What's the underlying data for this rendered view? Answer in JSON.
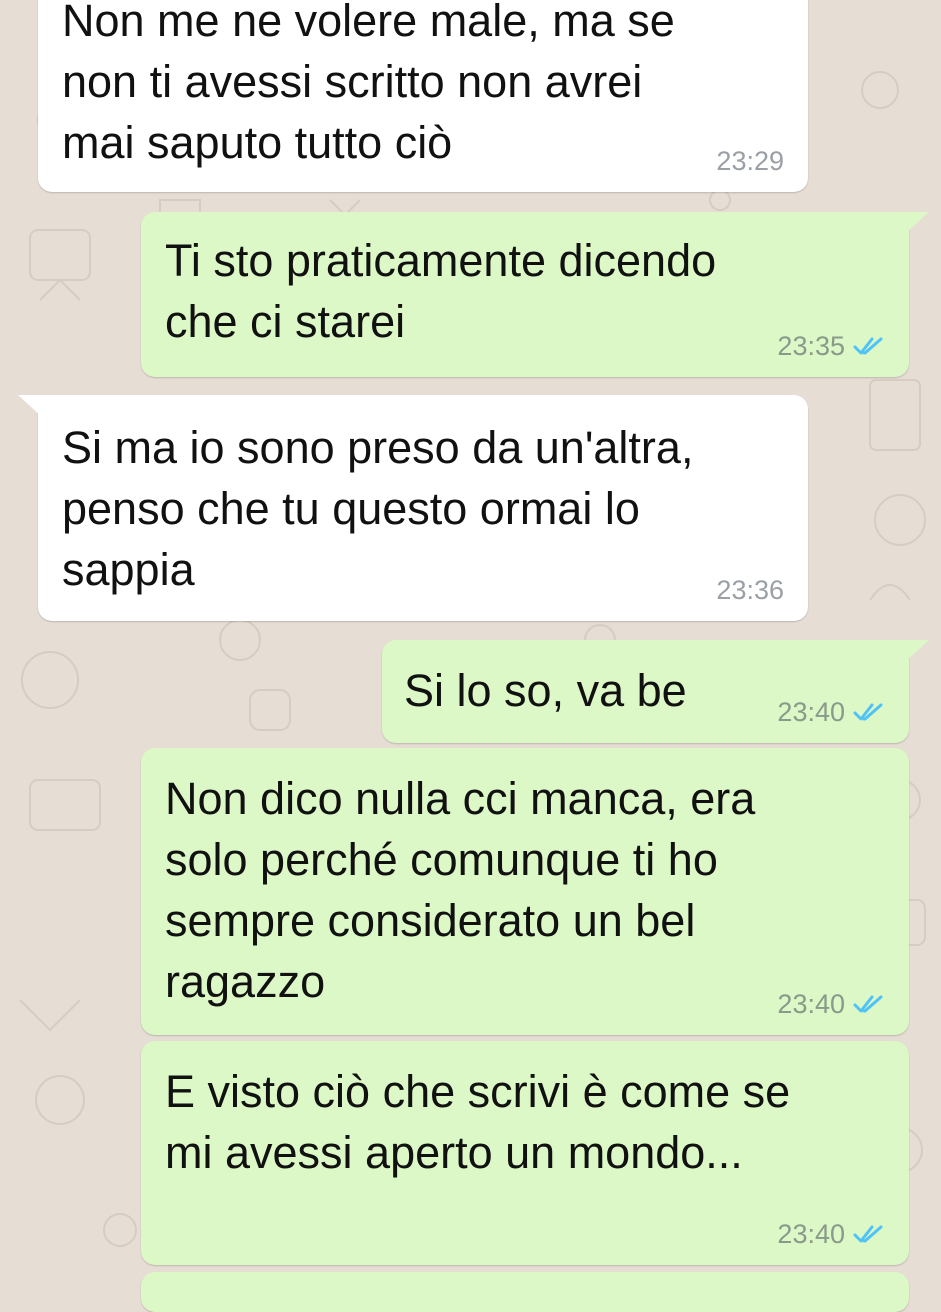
{
  "colors": {
    "wallpaper": "#e6ddd4",
    "incoming_bubble": "#ffffff",
    "outgoing_bubble": "#dcf8c6",
    "read_ticks": "#4fc3f7"
  },
  "messages": [
    {
      "direction": "incoming",
      "text": "Non me ne volere male, ma se\nnon ti avessi scritto non avrei\nmai saputo tutto ciò",
      "time": "23:29"
    },
    {
      "direction": "outgoing",
      "text": "Ti sto praticamente dicendo\nche ci starei",
      "time": "23:35",
      "status_icon": "double-check-read-icon"
    },
    {
      "direction": "incoming",
      "text": "Si ma io sono preso da un'altra,\npenso che tu questo ormai lo\nsappia",
      "time": "23:36"
    },
    {
      "direction": "outgoing",
      "text": "Si lo so, va be",
      "time": "23:40",
      "status_icon": "double-check-read-icon"
    },
    {
      "direction": "outgoing",
      "text": "Non dico nulla cci manca, era\nsolo perché comunque ti ho\nsempre considerato un bel\nragazzo",
      "time": "23:40",
      "status_icon": "double-check-read-icon"
    },
    {
      "direction": "outgoing",
      "text": "E visto ciò che scrivi è come se\nmi avessi aperto un mondo...",
      "time": "23:40",
      "status_icon": "double-check-read-icon"
    }
  ]
}
